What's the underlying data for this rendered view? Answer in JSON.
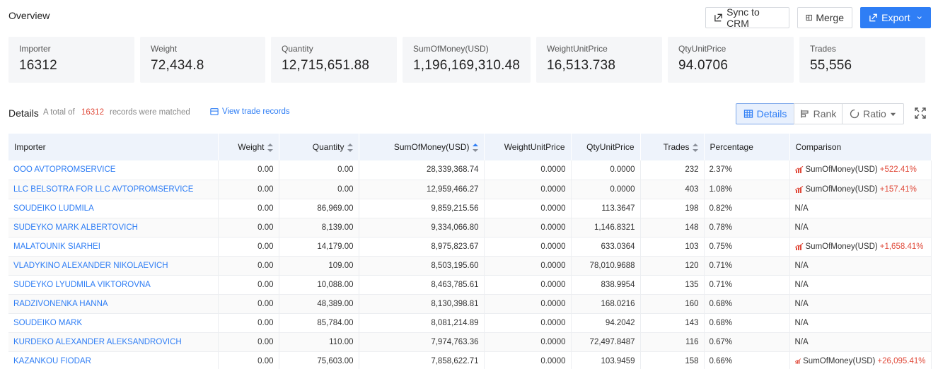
{
  "header": {
    "title": "Overview",
    "sync_label": "Sync to CRM",
    "merge_label": "Merge",
    "export_label": "Export"
  },
  "stats": [
    {
      "label": "Importer",
      "value": "16312"
    },
    {
      "label": "Weight",
      "value": "72,434.8"
    },
    {
      "label": "Quantity",
      "value": "12,715,651.88"
    },
    {
      "label": "SumOfMoney(USD)",
      "value": "1,196,169,310.48"
    },
    {
      "label": "WeightUnitPrice",
      "value": "16,513.738"
    },
    {
      "label": "QtyUnitPrice",
      "value": "94.0706"
    },
    {
      "label": "Trades",
      "value": "55,556"
    }
  ],
  "details": {
    "title": "Details",
    "total_prefix": "A total of",
    "count": "16312",
    "total_suffix": "records were matched",
    "view_link": "View trade records",
    "views": {
      "details": "Details",
      "rank": "Rank",
      "ratio": "Ratio"
    }
  },
  "table": {
    "columns": [
      "Importer",
      "Weight",
      "Quantity",
      "SumOfMoney(USD)",
      "WeightUnitPrice",
      "QtyUnitPrice",
      "Trades",
      "Percentage",
      "Comparison"
    ],
    "rows": [
      {
        "importer": "OOO AVTOPROMSERVICE",
        "weight": "0.00",
        "quantity": "0.00",
        "money": "28,339,368.74",
        "wup": "0.0000",
        "qup": "0.0000",
        "trades": "232",
        "pct": "2.37%",
        "cmp_label": "SumOfMoney(USD)",
        "cmp_value": "+522.41%"
      },
      {
        "importer": "LLC BELSOTRA FOR LLC AVTOPROMSERVICE",
        "weight": "0.00",
        "quantity": "0.00",
        "money": "12,959,466.27",
        "wup": "0.0000",
        "qup": "0.0000",
        "trades": "403",
        "pct": "1.08%",
        "cmp_label": "SumOfMoney(USD)",
        "cmp_value": "+157.41%"
      },
      {
        "importer": "SOUDEIKO LUDMILA",
        "weight": "0.00",
        "quantity": "86,969.00",
        "money": "9,859,215.56",
        "wup": "0.0000",
        "qup": "113.3647",
        "trades": "198",
        "pct": "0.82%",
        "cmp_label": "N/A",
        "cmp_value": ""
      },
      {
        "importer": "SUDEYKO MARK ALBERTOVICH",
        "weight": "0.00",
        "quantity": "8,139.00",
        "money": "9,334,066.80",
        "wup": "0.0000",
        "qup": "1,146.8321",
        "trades": "148",
        "pct": "0.78%",
        "cmp_label": "N/A",
        "cmp_value": ""
      },
      {
        "importer": "MALATOUNIK SIARHEI",
        "weight": "0.00",
        "quantity": "14,179.00",
        "money": "8,975,823.67",
        "wup": "0.0000",
        "qup": "633.0364",
        "trades": "103",
        "pct": "0.75%",
        "cmp_label": "SumOfMoney(USD)",
        "cmp_value": "+1,658.41%"
      },
      {
        "importer": "VLADYKINO ALEXANDER NIKOLAEVICH",
        "weight": "0.00",
        "quantity": "109.00",
        "money": "8,503,195.60",
        "wup": "0.0000",
        "qup": "78,010.9688",
        "trades": "120",
        "pct": "0.71%",
        "cmp_label": "N/A",
        "cmp_value": ""
      },
      {
        "importer": "SUDEYKO LYUDMILA VIKTOROVNA",
        "weight": "0.00",
        "quantity": "10,088.00",
        "money": "8,463,785.61",
        "wup": "0.0000",
        "qup": "838.9954",
        "trades": "135",
        "pct": "0.71%",
        "cmp_label": "N/A",
        "cmp_value": ""
      },
      {
        "importer": "RADZIVONENKA HANNA",
        "weight": "0.00",
        "quantity": "48,389.00",
        "money": "8,130,398.81",
        "wup": "0.0000",
        "qup": "168.0216",
        "trades": "160",
        "pct": "0.68%",
        "cmp_label": "N/A",
        "cmp_value": ""
      },
      {
        "importer": "SOUDEIKO MARK",
        "weight": "0.00",
        "quantity": "85,784.00",
        "money": "8,081,214.89",
        "wup": "0.0000",
        "qup": "94.2042",
        "trades": "143",
        "pct": "0.68%",
        "cmp_label": "N/A",
        "cmp_value": ""
      },
      {
        "importer": "KURDEKO ALEXANDER ALEKSANDROVICH",
        "weight": "0.00",
        "quantity": "110.00",
        "money": "7,974,763.36",
        "wup": "0.0000",
        "qup": "72,497.8487",
        "trades": "116",
        "pct": "0.67%",
        "cmp_label": "N/A",
        "cmp_value": ""
      },
      {
        "importer": "KAZANKOU FIODAR",
        "weight": "0.00",
        "quantity": "75,603.00",
        "money": "7,858,622.71",
        "wup": "0.0000",
        "qup": "103.9459",
        "trades": "158",
        "pct": "0.66%",
        "cmp_label": "SumOfMoney(USD)",
        "cmp_value": "+26,095.41%"
      }
    ]
  },
  "colors": {
    "accent": "#2f7ef5",
    "increase": "#e04a3a",
    "header_bg": "#eef3fb",
    "stat_bg": "#f5f6f8"
  }
}
